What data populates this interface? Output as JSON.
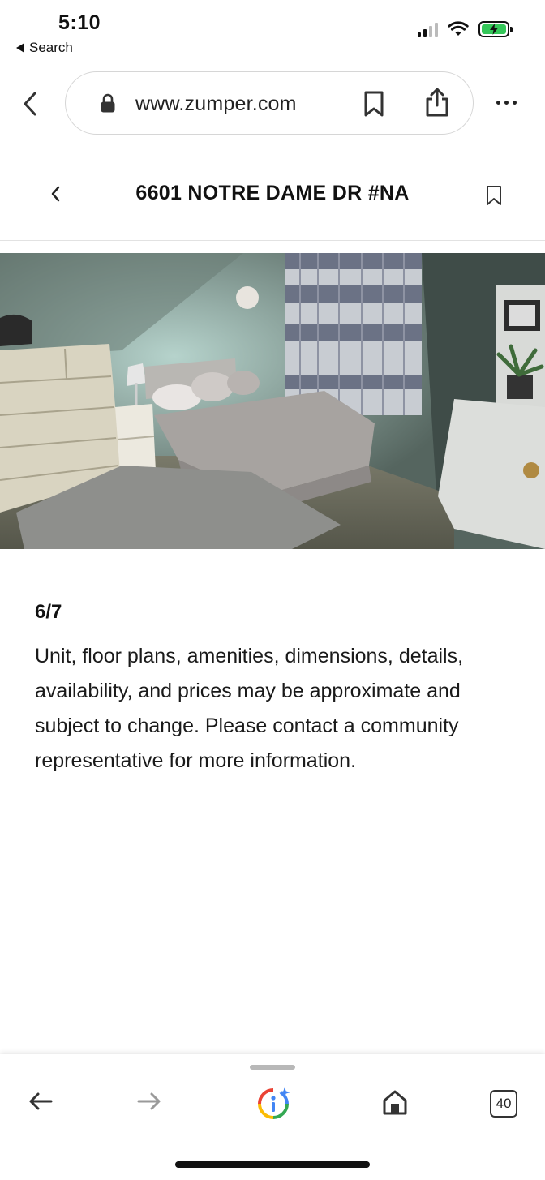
{
  "status_bar": {
    "time": "5:10",
    "back_label": "Search"
  },
  "browser": {
    "url": "www.zumper.com",
    "tab_count": "40"
  },
  "page": {
    "title": "6601 NOTRE DAME DR #NA",
    "photo_counter": "6/7",
    "disclaimer": "Unit, floor plans, amenities, dimensions, details, availability, and prices may be approximate and subject to change. Please contact a community representative for more information."
  },
  "icons": {
    "status": [
      "signal-icon",
      "wifi-icon",
      "battery-charging-icon"
    ],
    "browser": [
      "chevron-left-icon",
      "lock-icon",
      "bookmark-icon",
      "share-icon",
      "more-icon"
    ],
    "toolbar": [
      "back-arrow-icon",
      "forward-arrow-icon",
      "google-lens-icon",
      "home-icon",
      "tab-switcher-icon"
    ]
  },
  "colors": {
    "battery": "#34c759",
    "accent_text": "#111111",
    "divider": "#e2e2e2"
  }
}
